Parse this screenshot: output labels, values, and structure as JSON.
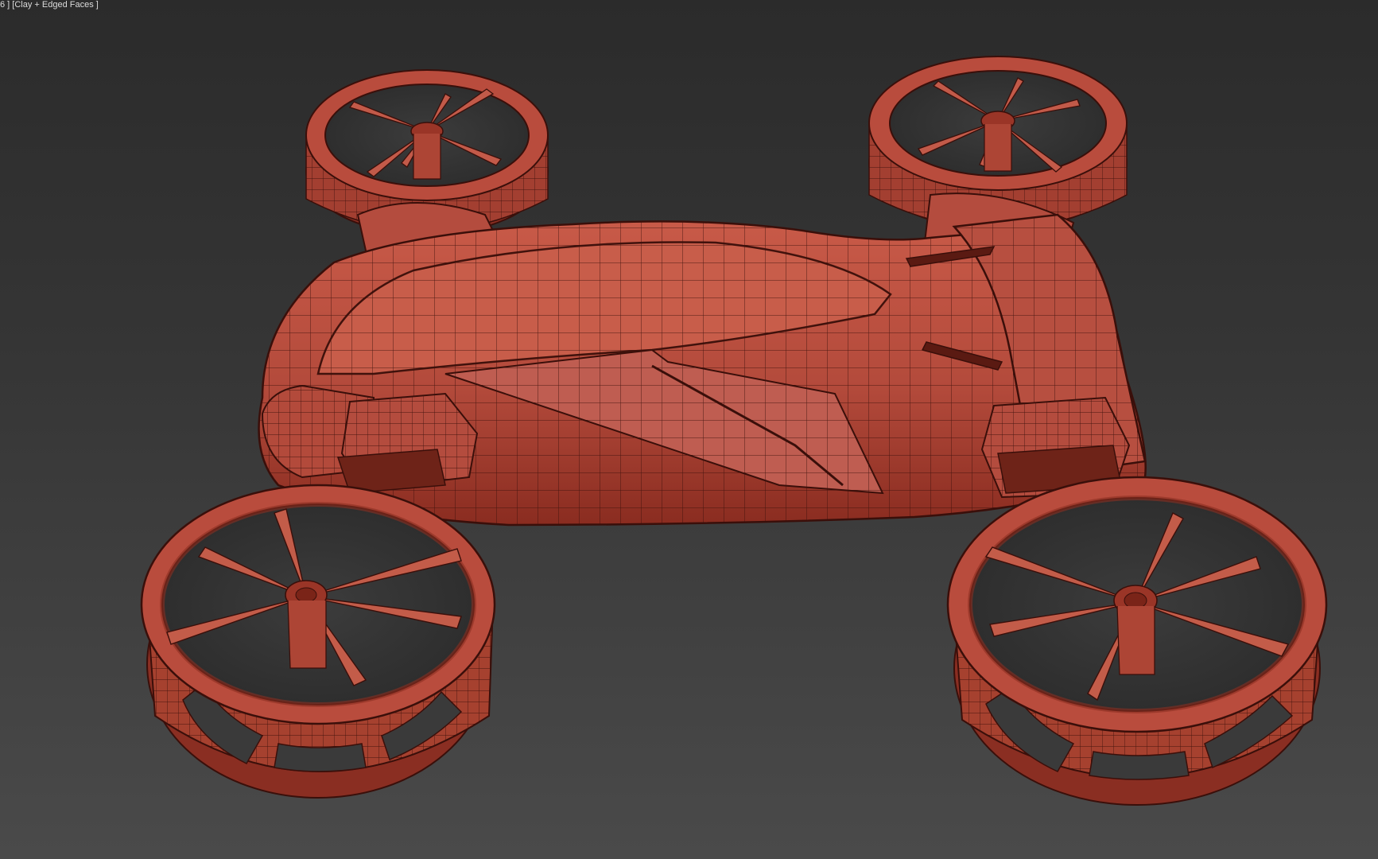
{
  "viewport": {
    "label": "6 ] [Clay + Edged Faces ]",
    "shading_mode": "Clay + Edged Faces",
    "colors": {
      "background_top": "#2b2b2b",
      "background_bottom": "#4a4a4a",
      "clay": "#b54a3c",
      "clay_dark": "#7a2418",
      "wire": "#3a0f0a"
    }
  }
}
